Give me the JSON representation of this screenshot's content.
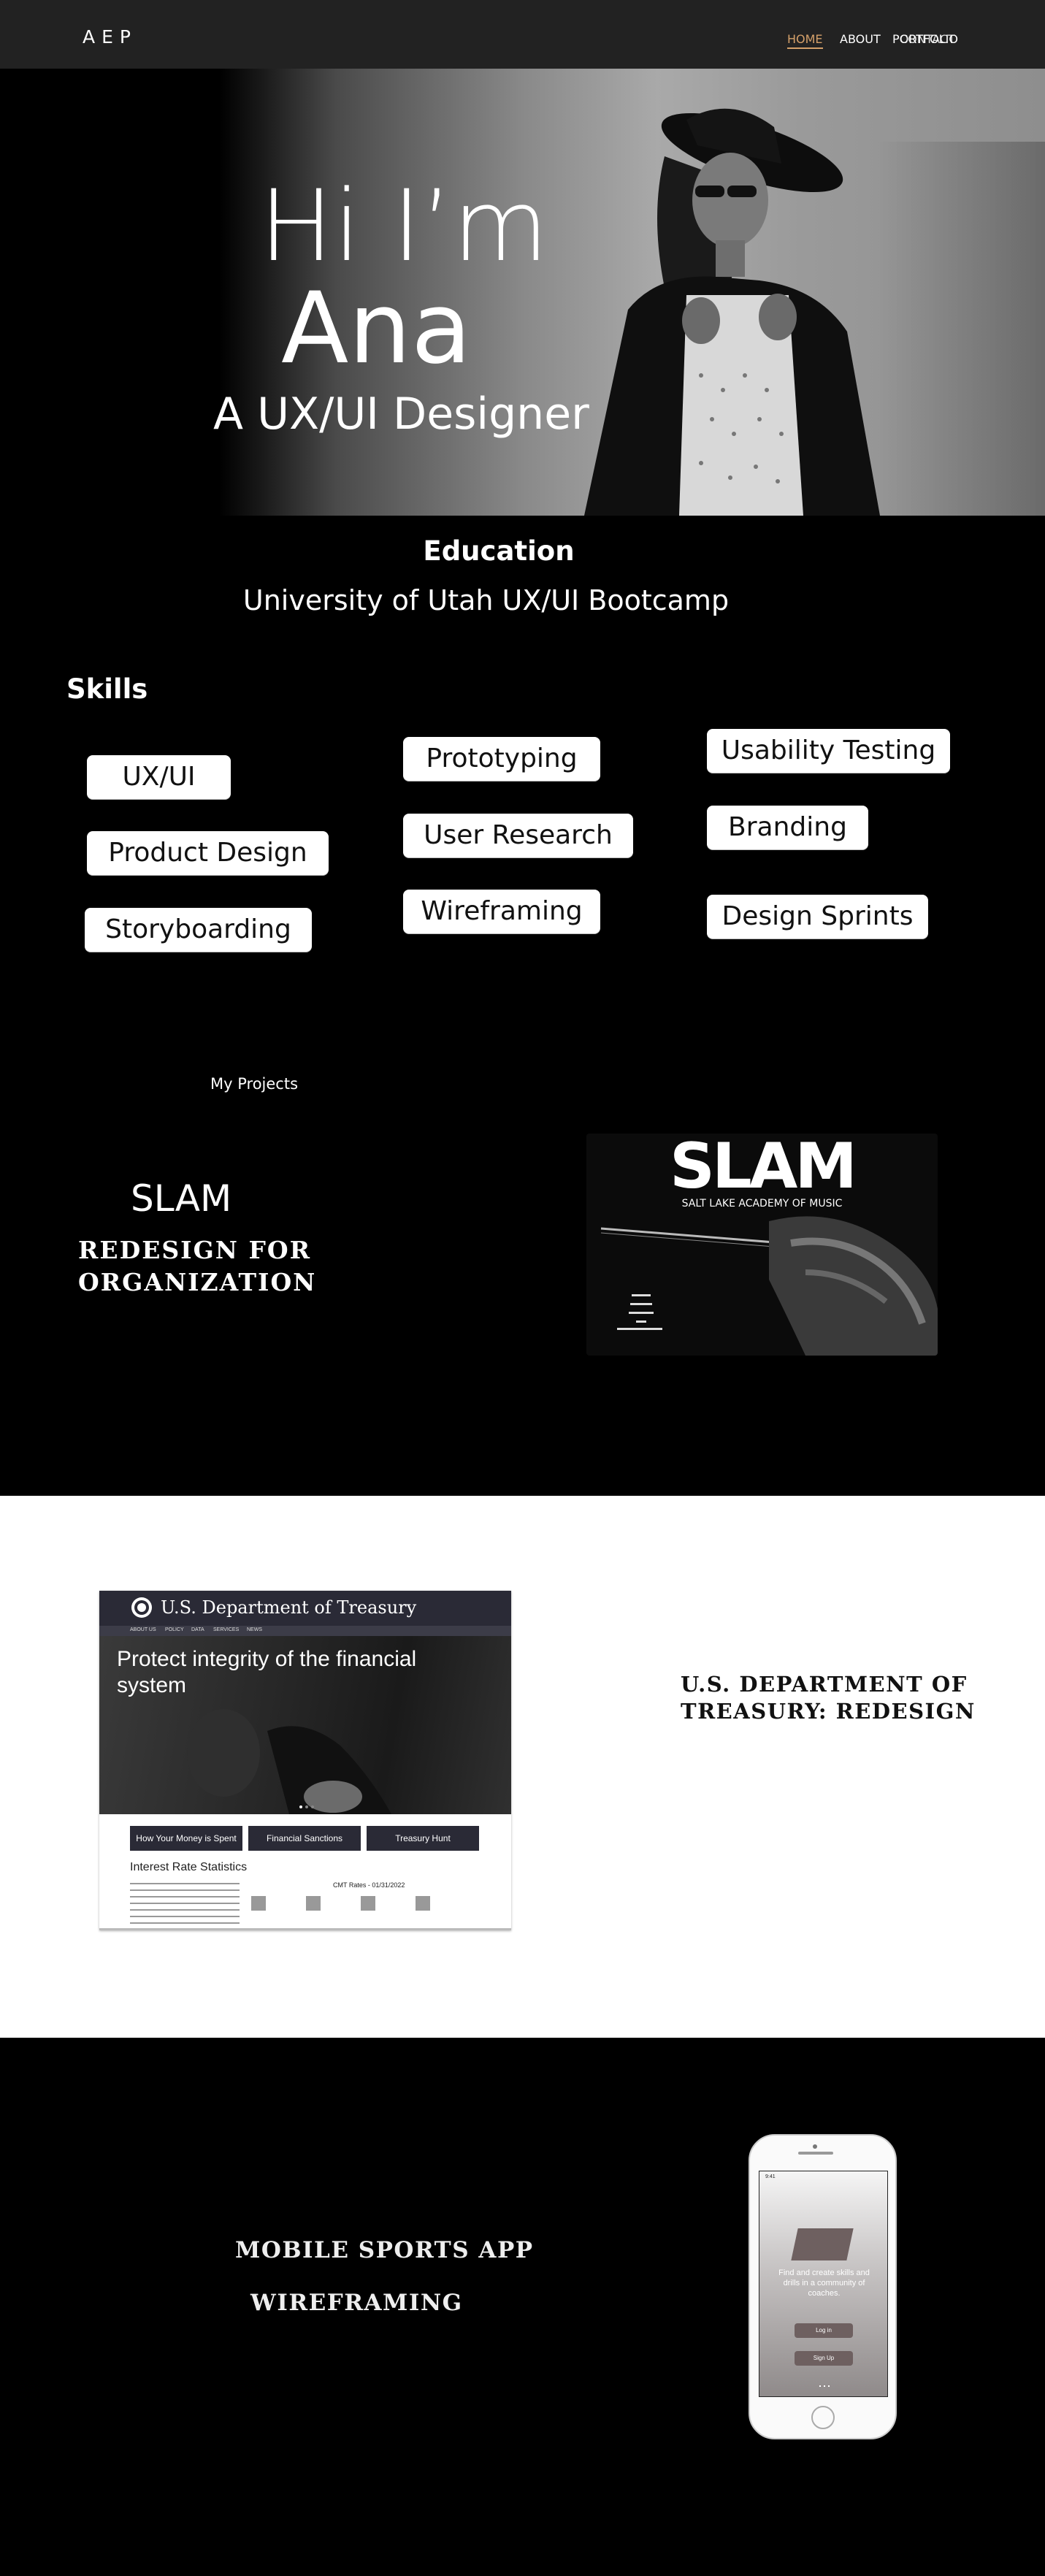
{
  "nav": {
    "logo": "AEP",
    "links": {
      "home": "HOME",
      "about": "ABOUT",
      "portfolio": "PORTFOLIO",
      "contact": "CONTACT"
    },
    "active_color": "#d4a06a"
  },
  "hero": {
    "line1": "Hi I’m",
    "line2": "Ana",
    "subtitle": "A UX/UI Designer"
  },
  "education": {
    "title": "Education",
    "school": "University of Utah UX/UI Bootcamp"
  },
  "skills": {
    "title": "Skills",
    "items": [
      "UX/UI",
      "Product Design",
      "Storyboarding",
      "Prototyping",
      "User Research",
      "Wireframing",
      "Usability Testing",
      "Branding",
      "Design Sprints"
    ]
  },
  "projects": {
    "title": "My Projects",
    "slam": {
      "title": "SLAM",
      "subtitle_line1": "REDESIGN FOR",
      "subtitle_line2": "ORGANIZATION",
      "preview_logo": "SLAM",
      "preview_tagline": "SALT LAKE ACADEMY OF MUSIC"
    },
    "treasury": {
      "title_line1": "U.S. DEPARTMENT OF",
      "title_line2": "TREASURY: REDESIGN",
      "preview": {
        "site_name": "U.S. Department of Treasury",
        "nav": [
          "ABOUT US",
          "POLICY",
          "DATA",
          "SERVICES",
          "NEWS"
        ],
        "headline": "Protect integrity of the financial system",
        "buttons": [
          "How Your Money is Spent",
          "Financial Sanctions",
          "Treasury Hunt"
        ],
        "section_title": "Interest Rate Statistics",
        "table_title": "CMT Rates - 01/31/2022"
      }
    },
    "mobile": {
      "title_line1": "MOBILE SPORTS APP",
      "title_line2": "WIREFRAMING",
      "preview": {
        "time": "9:41",
        "tagline": "Find and create skills and drills in a community of coaches.",
        "login": "Log in",
        "signup": "Sign Up"
      }
    }
  }
}
